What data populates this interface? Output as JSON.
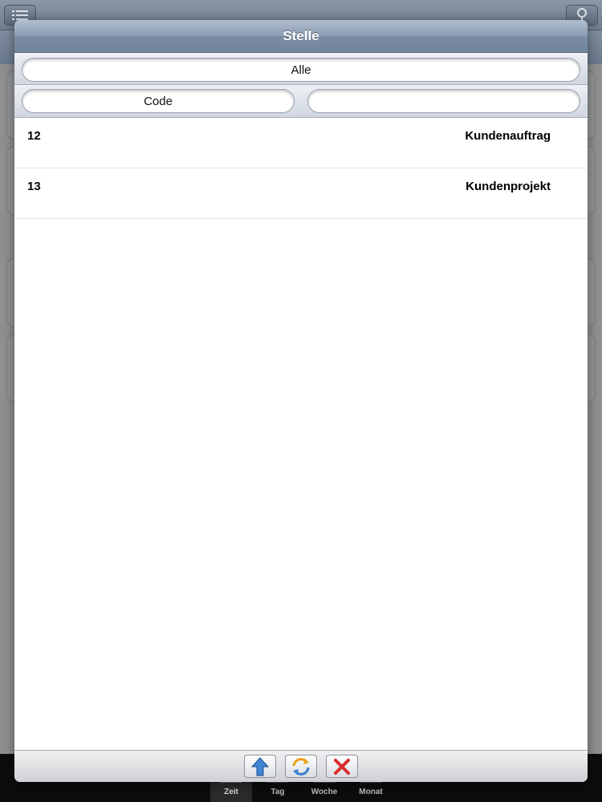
{
  "modal": {
    "title": "Stelle",
    "filter_scope": "Alle",
    "field_code": "Code",
    "search_value": ""
  },
  "rows": [
    {
      "code": "12",
      "name": "Kundenauftrag"
    },
    {
      "code": "13",
      "name": "Kundenprojekt"
    }
  ],
  "toolbar": {
    "buttons": [
      "up-arrow-icon",
      "refresh-icon",
      "close-x-icon"
    ]
  },
  "tabs": [
    {
      "label": "Zeit",
      "active": true
    },
    {
      "label": "Tag",
      "active": false
    },
    {
      "label": "Woche",
      "active": false
    },
    {
      "label": "Monat",
      "active": false
    }
  ],
  "colors": {
    "header_bar": "#8c9db3",
    "up_arrow": "#3f83d6",
    "close_x": "#d92c2c"
  }
}
